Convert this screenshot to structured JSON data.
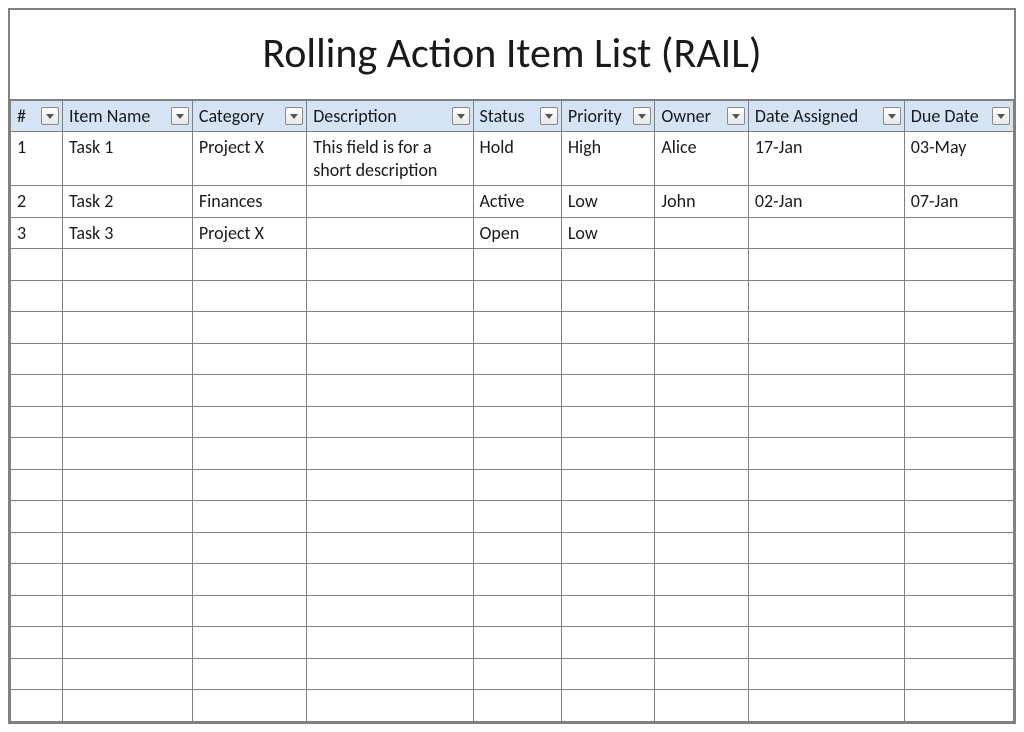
{
  "title": "Rolling Action Item List (RAIL)",
  "columns": [
    {
      "key": "id",
      "label": "#"
    },
    {
      "key": "item_name",
      "label": "Item Name"
    },
    {
      "key": "category",
      "label": "Category"
    },
    {
      "key": "description",
      "label": "Description"
    },
    {
      "key": "status",
      "label": "Status"
    },
    {
      "key": "priority",
      "label": "Priority"
    },
    {
      "key": "owner",
      "label": "Owner"
    },
    {
      "key": "date_assigned",
      "label": "Date Assigned"
    },
    {
      "key": "due_date",
      "label": "Due Date"
    }
  ],
  "rows": [
    {
      "id": "1",
      "item_name": "Task 1",
      "category": "Project X",
      "description": "This field is for a short description",
      "status": "Hold",
      "priority": "High",
      "owner": "Alice",
      "date_assigned": "17-Jan",
      "due_date": "03-May"
    },
    {
      "id": "2",
      "item_name": "Task 2",
      "category": "Finances",
      "description": "",
      "status": "Active",
      "priority": "Low",
      "owner": "John",
      "date_assigned": "02-Jan",
      "due_date": "07-Jan"
    },
    {
      "id": "3",
      "item_name": "Task 3",
      "category": "Project X",
      "description": "",
      "status": "Open",
      "priority": "Low",
      "owner": "",
      "date_assigned": "",
      "due_date": ""
    }
  ],
  "empty_row_count": 15,
  "colors": {
    "header_bg": "#d4e4f5",
    "border": "#808080"
  }
}
